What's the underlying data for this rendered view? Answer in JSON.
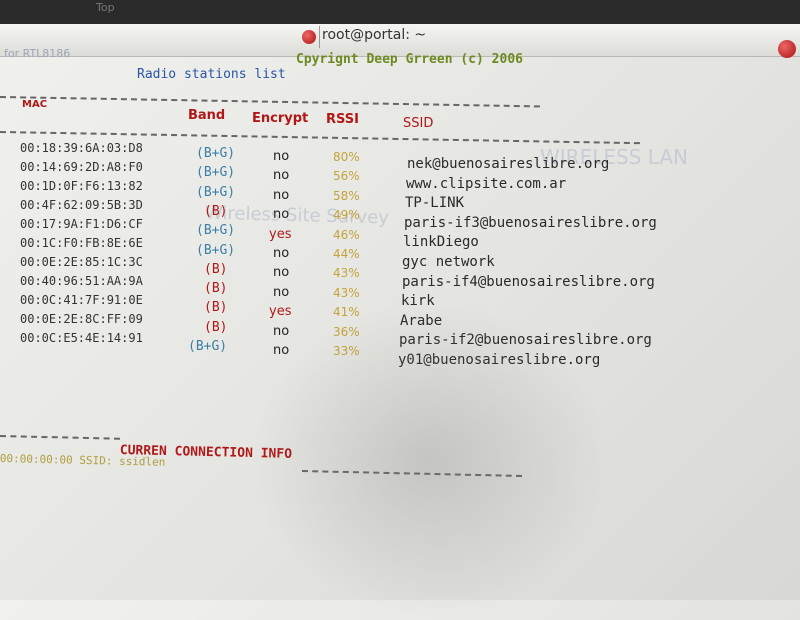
{
  "window": {
    "app_label": "Top",
    "title": "root@portal: ~"
  },
  "header": {
    "left_text": "for RTL8186",
    "copyright": "Cpyrignt Deep Grreen (c) 2006",
    "panel_title": "Radio stations list"
  },
  "columns": {
    "mac": "MAC",
    "band": "Band",
    "encrypt": "Encrypt",
    "rssi": "RSSI",
    "ssid": "SSID"
  },
  "colors": {
    "band_bg": "#3a7fa8",
    "band_b": "#b01818",
    "encrypt_yes": "#b01818"
  },
  "stations": [
    {
      "mac": "00:18:39:6A:03:D8",
      "band": "(B+G)",
      "encrypt": "no",
      "rssi": "80%",
      "ssid": "nek@buenosaireslibre.org"
    },
    {
      "mac": "00:14:69:2D:A8:F0",
      "band": "(B+G)",
      "encrypt": "no",
      "rssi": "56%",
      "ssid": "www.clipsite.com.ar"
    },
    {
      "mac": "00:1D:0F:F6:13:82",
      "band": "(B+G)",
      "encrypt": "no",
      "rssi": "58%",
      "ssid": "TP-LINK"
    },
    {
      "mac": "00:4F:62:09:5B:3D",
      "band": "(B)",
      "encrypt": "no",
      "rssi": "49%",
      "ssid": "paris-if3@buenosaireslibre.org"
    },
    {
      "mac": "00:17:9A:F1:D6:CF",
      "band": "(B+G)",
      "encrypt": "yes",
      "rssi": "46%",
      "ssid": "linkDiego"
    },
    {
      "mac": "00:1C:F0:FB:8E:6E",
      "band": "(B+G)",
      "encrypt": "no",
      "rssi": "44%",
      "ssid": "gyc network"
    },
    {
      "mac": "00:0E:2E:85:1C:3C",
      "band": "(B)",
      "encrypt": "no",
      "rssi": "43%",
      "ssid": "paris-if4@buenosaireslibre.org"
    },
    {
      "mac": "00:40:96:51:AA:9A",
      "band": "(B)",
      "encrypt": "no",
      "rssi": "43%",
      "ssid": "kirk"
    },
    {
      "mac": "00:0C:41:7F:91:0E",
      "band": "(B)",
      "encrypt": "yes",
      "rssi": "41%",
      "ssid": "Arabe"
    },
    {
      "mac": "00:0E:2E:8C:FF:09",
      "band": "(B)",
      "encrypt": "no",
      "rssi": "36%",
      "ssid": "paris-if2@buenosaireslibre.org"
    },
    {
      "mac": "00:0C:E5:4E:14:91",
      "band": "(B+G)",
      "encrypt": "no",
      "rssi": "33%",
      "ssid": "y01@buenosaireslibre.org"
    }
  ],
  "connection": {
    "title": "CURREN CONNECTION INFO",
    "ssid_line": "00:00:00:00 SSID: ssidlen"
  },
  "ghost_text": {
    "wireless": "WIRELESS LAN",
    "site_survey": "Wireless Site Survey"
  }
}
